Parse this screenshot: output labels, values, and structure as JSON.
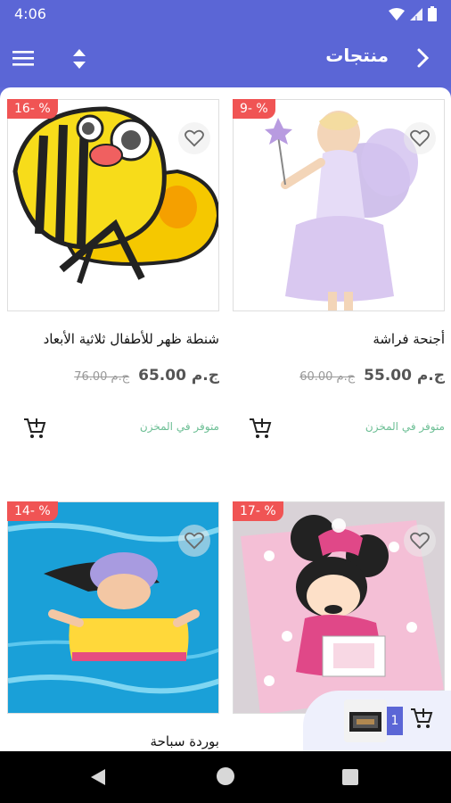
{
  "status_bar": {
    "time": "4:06"
  },
  "app_bar": {
    "title": "منتجات"
  },
  "products": [
    {
      "name": "أجنحة فراشة",
      "discount": "9- %",
      "price": "ج.م 55.00",
      "old_price": "60.00 ج.م",
      "stock": "متوفر في المخزن"
    },
    {
      "name": "شنطة ظهر للأطفال  ثلاثية الأبعاد",
      "discount": "16- %",
      "price": "ج.م 65.00",
      "old_price": "76.00 ج.م",
      "stock": "متوفر في المخزن"
    },
    {
      "name": "",
      "discount": "17- %"
    },
    {
      "name": "بوردة سباحة",
      "discount": "14- %"
    }
  ],
  "cart": {
    "count": "1"
  },
  "colors": {
    "primary": "#5b66d6",
    "badge": "#f05454",
    "stock": "#6dbf95"
  }
}
